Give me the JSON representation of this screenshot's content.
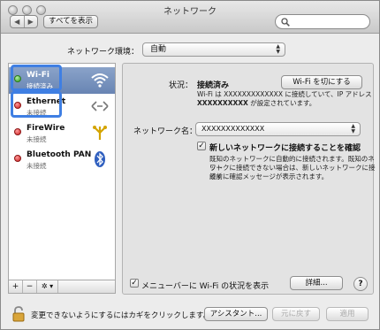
{
  "window": {
    "title": "ネットワーク"
  },
  "toolbar": {
    "back": "◀",
    "forward": "▶",
    "show_all": "すべてを表示",
    "search_placeholder": ""
  },
  "location": {
    "label": "ネットワーク環境：",
    "value": "自動"
  },
  "services": [
    {
      "name": "Wi-Fi",
      "status": "接続済み",
      "indicator": "green",
      "icon": "wifi-icon"
    },
    {
      "name": "Ethernet",
      "status": "未接続",
      "indicator": "red",
      "icon": "ethernet-icon"
    },
    {
      "name": "FireWire",
      "status": "未接続",
      "indicator": "red",
      "icon": "firewire-icon"
    },
    {
      "name": "Bluetooth PAN",
      "status": "未接続",
      "indicator": "red",
      "icon": "bluetooth-icon"
    }
  ],
  "list_tools": {
    "add": "+",
    "remove": "−",
    "gear": "✲ ▾"
  },
  "detail": {
    "status_label": "状況：",
    "status_value": "接続済み",
    "wifi_off_button": "Wi-Fi を切にする",
    "status_desc_line1": "Wi-Fi は XXXXXXXXXXXXX に接続していて、IP アドレス",
    "status_desc_line2a": "XXXXXXXXXX",
    "status_desc_line2b": " が設定されています。",
    "network_name_label": "ネットワーク名：",
    "network_name_value": "XXXXXXXXXXXXX",
    "ask_join_label": "新しいネットワークに接続することを確認",
    "ask_join_checked": true,
    "ask_desc_line1": "既知のネットワークに自動的に接続されます。既知のネット",
    "ask_desc_line2": "ワークに接続できない場合は、新しいネットワークに接続す",
    "ask_desc_line3": "る前に確認メッセージが表示されます。",
    "menubar_label": "メニューバーに Wi-Fi の状況を表示",
    "menubar_checked": true,
    "advanced_button": "詳細...",
    "help": "?"
  },
  "footer": {
    "lock_text": "変更できないようにするにはカギをクリックします。",
    "assist_button": "アシスタント...",
    "revert_button": "元に戻す",
    "apply_button": "適用"
  },
  "colors": {
    "selection": "#6f8bb8",
    "highlight_box": "#3f7fe3",
    "connected": "#2e9d1c",
    "disconnected": "#cc1f1f"
  }
}
